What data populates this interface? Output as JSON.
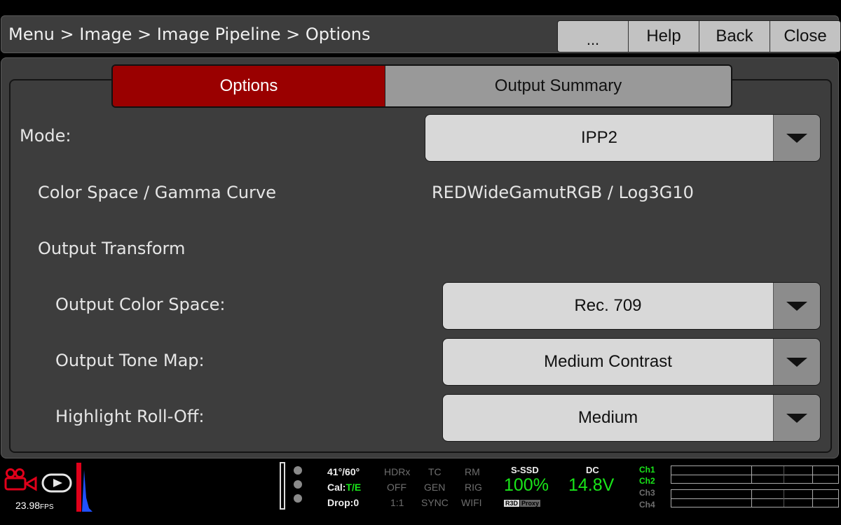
{
  "header": {
    "breadcrumb": "Menu > Image > Image Pipeline > Options",
    "buttons": {
      "more": "...",
      "help": "Help",
      "back": "Back",
      "close": "Close"
    }
  },
  "tabs": {
    "options": "Options",
    "output_summary": "Output Summary"
  },
  "settings": {
    "mode": {
      "label": "Mode:",
      "value": "IPP2"
    },
    "color_space_gamma": {
      "label": "Color Space / Gamma Curve",
      "value": "REDWideGamutRGB / Log3G10"
    },
    "output_transform": {
      "label": "Output Transform"
    },
    "output_color_space": {
      "label": "Output Color Space:",
      "value": "Rec. 709"
    },
    "output_tone_map": {
      "label": "Output Tone Map:",
      "value": "Medium Contrast"
    },
    "highlight_rolloff": {
      "label": "Highlight Roll-Off:",
      "value": "Medium"
    }
  },
  "status": {
    "fps": "23.98",
    "fps_unit": "FPS",
    "shutter": "41°/60°",
    "cal_prefix": "Cal:",
    "cal_value": "T/E",
    "drop": "Drop:0",
    "hdrx": {
      "label": "HDRx",
      "value": "OFF",
      "ratio": "1:1"
    },
    "tc": {
      "label": "TC",
      "value": "GEN",
      "sub": "SYNC"
    },
    "rm": {
      "label": "RM",
      "value": "RIG",
      "sub": "WIFI"
    },
    "media": {
      "label": "S-SSD",
      "value": "100%",
      "tag1": "R3D",
      "tag2": "Proxy"
    },
    "power": {
      "label": "DC",
      "value": "14.8V"
    },
    "channels": [
      "Ch1",
      "Ch2",
      "Ch3",
      "Ch4"
    ],
    "colors": {
      "accent_green": "#19e619",
      "record_red": "#e0001a",
      "tab_red": "#9a0000"
    }
  }
}
